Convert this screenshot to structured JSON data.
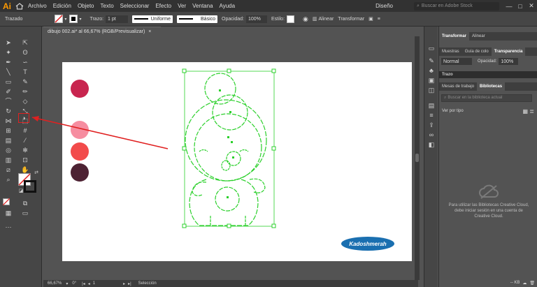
{
  "app": {
    "logo": "Ai",
    "workspace": "Diseño",
    "search_placeholder": "Buscar en Adobe Stock"
  },
  "menu": [
    "Archivo",
    "Edición",
    "Objeto",
    "Texto",
    "Seleccionar",
    "Efecto",
    "Ver",
    "Ventana",
    "Ayuda"
  ],
  "window_controls": {
    "minimize": "—",
    "maximize": "□",
    "close": "✕"
  },
  "control_bar": {
    "mode_label": "Trazado",
    "stroke_label": "Trazo:",
    "stroke_value": "1 pt",
    "profile_label": "Uniforme",
    "brush_label": "Básico",
    "opacity_label": "Opacidad:",
    "opacity_value": "100%",
    "style_label": "Estilo:",
    "align_label": "Alinear",
    "transform_label": "Transformar"
  },
  "document": {
    "tab_title": "dibujo 002.ai* al 66,67% (RGB/Previsualizar)",
    "tab_close": "×"
  },
  "artboard": {
    "swatches": [
      "#c8254f",
      "#f68da0",
      "#f24b4b",
      "#4d2233"
    ],
    "label_text": "Kadoshmerah",
    "label_color": "#1a6fb0",
    "selection_color": "#2bd02b",
    "arrow_color": "#e02020"
  },
  "status_bar": {
    "zoom": "66,67%",
    "rotation": "0°",
    "page": "1",
    "tool": "Selección"
  },
  "right_panel": {
    "tabs_top": [
      "Transformar",
      "Alinear"
    ],
    "tabs_second": [
      "Muestras",
      "Guía de colo",
      "Transparencia"
    ],
    "blend_mode": "Normal",
    "opacity_label": "Opacidad:",
    "opacity_value": "100%",
    "section_trazo": "Trazo",
    "tabs_third": [
      "Mesas de trabajo",
      "Bibliotecas"
    ],
    "library_search_placeholder": "Buscar en la biblioteca actual",
    "view_by": "Ver por tipo",
    "cc_message": "Para utilizar las Bibliotecas Creative Cloud, debe iniciar sesión en una cuenta de Creative Cloud.",
    "footer_size": "-- KB"
  }
}
